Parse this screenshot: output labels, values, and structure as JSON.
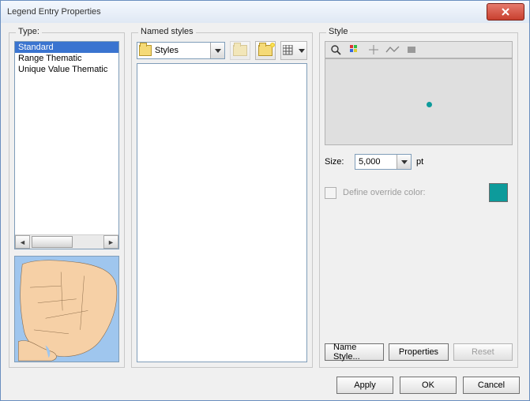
{
  "window": {
    "title": "Legend Entry Properties"
  },
  "type": {
    "label": "Type:",
    "items": [
      "Standard",
      "Range Thematic",
      "Unique Value Thematic"
    ],
    "selected_index": 0
  },
  "named_styles": {
    "label": "Named styles",
    "combo_value": "Styles"
  },
  "style": {
    "label": "Style",
    "size_label": "Size:",
    "size_value": "5,000",
    "size_unit": "pt",
    "override_label": "Define override color:",
    "override_checked": false,
    "override_color": "#0d9b9b",
    "buttons": {
      "name_style": "Name Style...",
      "properties": "Properties",
      "reset": "Reset"
    }
  },
  "footer": {
    "apply": "Apply",
    "ok": "OK",
    "cancel": "Cancel"
  }
}
